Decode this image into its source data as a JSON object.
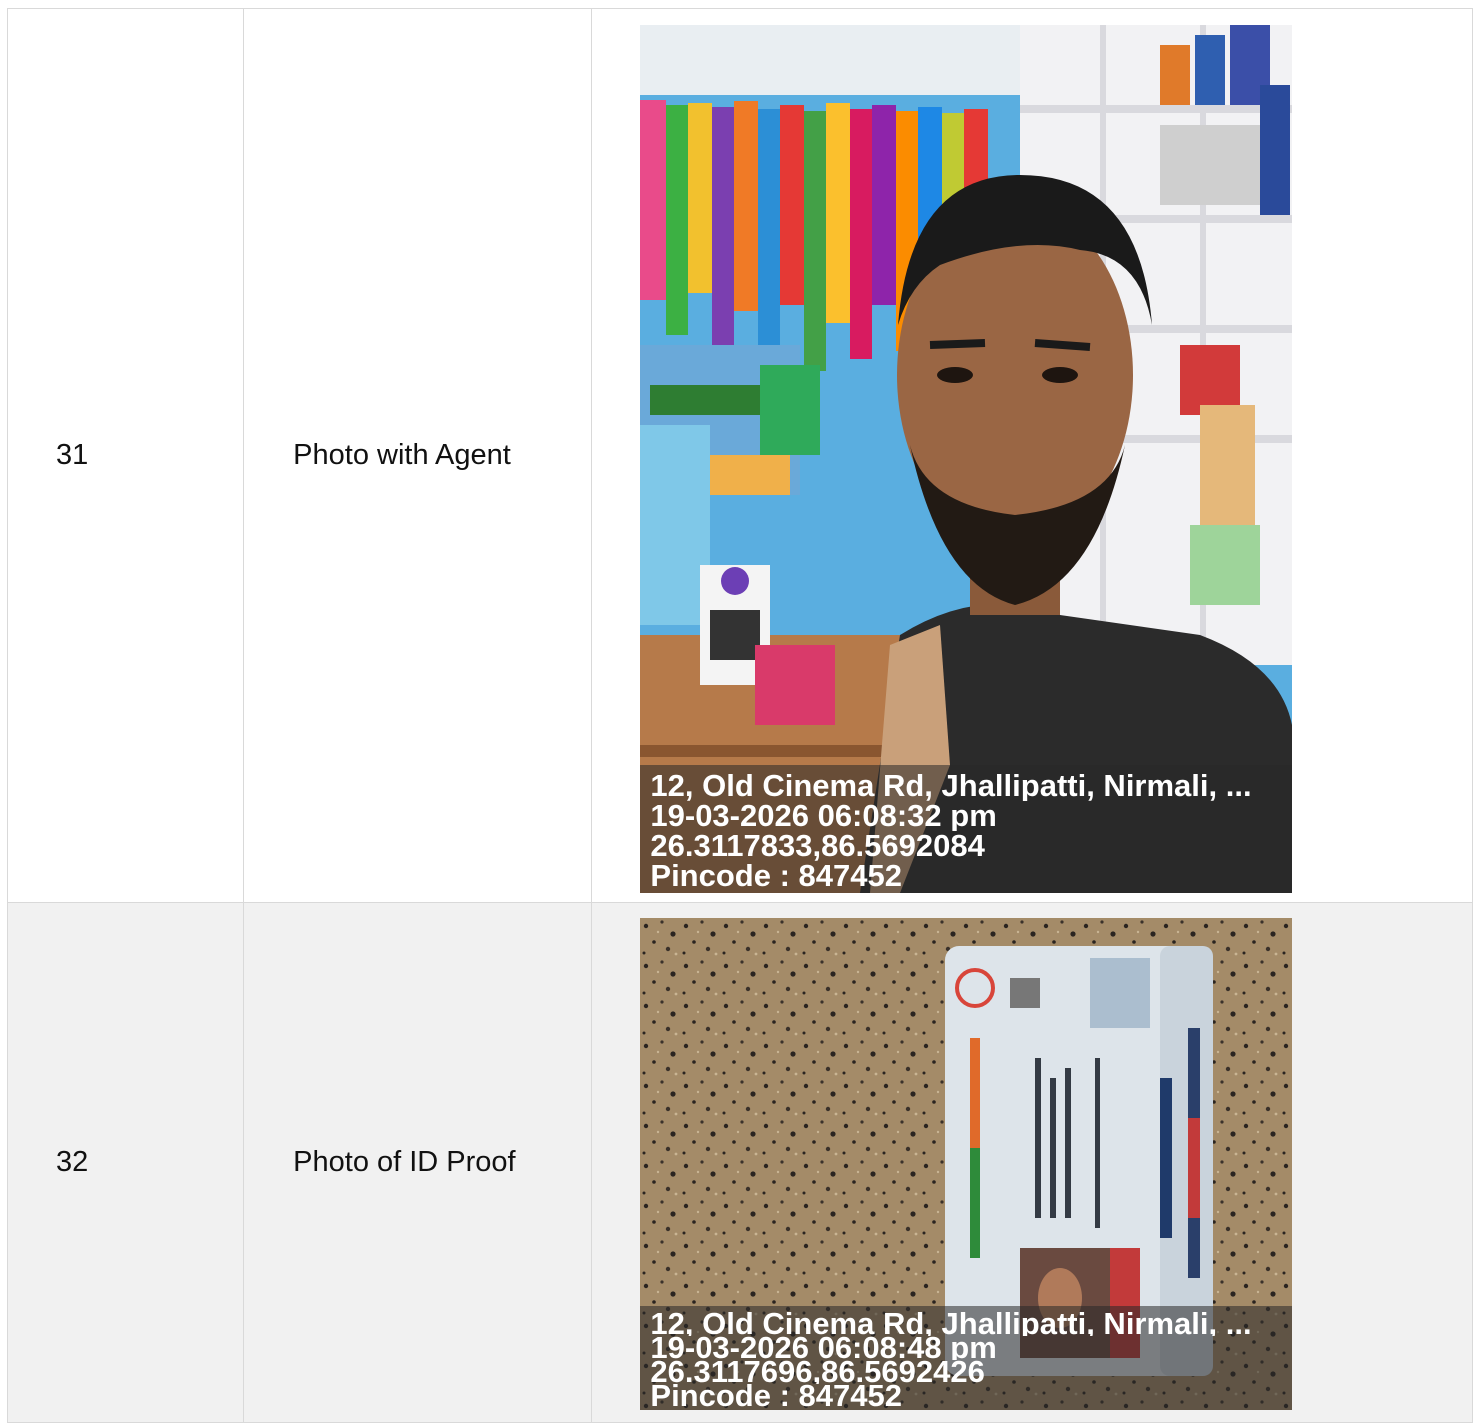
{
  "rows": [
    {
      "number": "31",
      "label": "Photo with Agent",
      "photo_overlay": {
        "address": "12, Old Cinema Rd, Jhallipatti, Nirmali, ...",
        "datetime": "19-03-2026 06:08:32 pm",
        "coordinates": "26.3117833,86.5692084",
        "pincode": "Pincode : 847452"
      }
    },
    {
      "number": "32",
      "label": "Photo of ID Proof",
      "photo_overlay": {
        "address": "12, Old Cinema Rd, Jhallipatti, Nirmali, ...",
        "datetime": "19-03-2026 06:08:48 pm",
        "coordinates": "26.3117696,86.5692426",
        "pincode": "Pincode : 847452"
      }
    }
  ]
}
